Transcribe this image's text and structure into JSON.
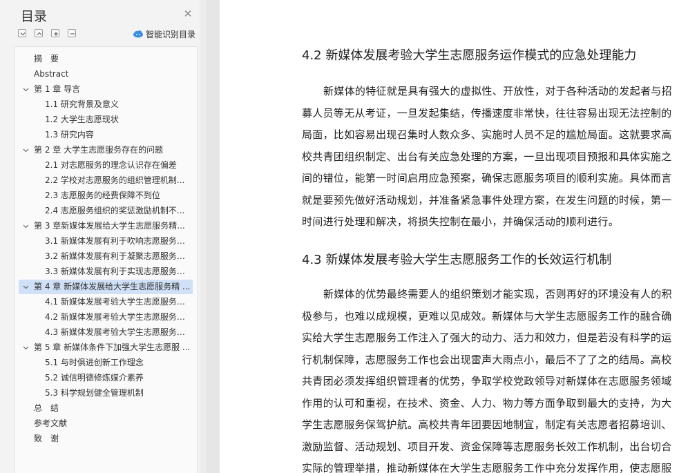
{
  "sidebar": {
    "title": "目录",
    "smart_label": "智能识别目录",
    "toc": [
      {
        "label": "摘　要",
        "level": 0,
        "chevron": false
      },
      {
        "label": "Abstract",
        "level": 0,
        "chevron": false
      },
      {
        "label": "第 1 章  导言",
        "level": 0,
        "chevron": true
      },
      {
        "label": "1.1 研究背景及意义",
        "level": 1,
        "chevron": false
      },
      {
        "label": "1.2 大学生志愿现状",
        "level": 1,
        "chevron": false
      },
      {
        "label": "1.3 研究内容",
        "level": 1,
        "chevron": false
      },
      {
        "label": "第 2 章  大学生志愿服务存在的问题",
        "level": 0,
        "chevron": true
      },
      {
        "label": "2.1 对志愿服务的理念认识存在偏差",
        "level": 1,
        "chevron": false
      },
      {
        "label": "2.2 学校对志愿服务的组织管理机制...",
        "level": 1,
        "chevron": false
      },
      {
        "label": "2.3 志愿服务的经费保障不到位",
        "level": 1,
        "chevron": false
      },
      {
        "label": "2.4 志愿服务组织的奖惩激励机制不...",
        "level": 1,
        "chevron": false
      },
      {
        "label": "第 3 章新媒体发展给大学生志愿服务精...",
        "level": 0,
        "chevron": true
      },
      {
        "label": "3.1 新媒体发展有利于吹响志愿服务 ...",
        "level": 1,
        "chevron": false
      },
      {
        "label": "3.2 新媒体发展有利于凝聚志愿服务 ...",
        "level": 1,
        "chevron": false
      },
      {
        "label": "3.3 新媒体发展有利于实现志愿服务 ...",
        "level": 1,
        "chevron": false
      },
      {
        "label": "第 4 章  新媒体发展给大学生志愿服务精 ...",
        "level": 0,
        "chevron": true,
        "active": true
      },
      {
        "label": "4.1 新媒体发展考验大学生志愿服务 ...",
        "level": 1,
        "chevron": false
      },
      {
        "label": "4.2 新媒体发展考验大学生志愿服务 ...",
        "level": 1,
        "chevron": false
      },
      {
        "label": "4.3 新媒体发展考验大学生志愿服务 ...",
        "level": 1,
        "chevron": false
      },
      {
        "label": "第 5 章  新媒体条件下加强大学生志愿服 ...",
        "level": 0,
        "chevron": true
      },
      {
        "label": "5.1 与时俱进创新工作理念",
        "level": 1,
        "chevron": false
      },
      {
        "label": "5.2 诚信明德修炼媒介素养",
        "level": 1,
        "chevron": false
      },
      {
        "label": "5.3 科学规划健全管理机制",
        "level": 1,
        "chevron": false
      },
      {
        "label": "总　结",
        "level": 0,
        "chevron": false
      },
      {
        "label": "参考文献",
        "level": 0,
        "chevron": false
      },
      {
        "label": "致　谢",
        "level": 0,
        "chevron": false
      }
    ]
  },
  "document": {
    "heading1": "4.2 新媒体发展考验大学生志愿服务运作模式的应急处理能力",
    "para1": [
      "新媒体的特征就是具有强大的虚拟性、开放性，对于各种活动的发起者与招",
      "募人员等无从考证，一旦发起集结，传播速度非常快，往往容易出现无法控制的",
      "局面，比如容易出现召集时人数众多、实施时人员不足的尴尬局面。这就要求高",
      "校共青团组织制定、出台有关应急处理的方案，一旦出现项目预报和具体实施之",
      "间的错位，能第一时间启用应急预案，确保志愿服务项目的顺利实施。具体而言",
      "就是要预先做好活动规划，并准备紧急事件处理方案，在发生问题的时候，第一",
      "时间进行处理和解决，将损失控制在最小，并确保活动的顺利进行。"
    ],
    "heading2": "4.3 新媒体发展考验大学生志愿服务工作的长效运行机制",
    "para2": [
      "新媒体的优势最终需要人的组织策划才能实现，否则再好的环境没有人的积",
      "极参与，也难以成规模，更难以见成效。新媒体与大学生志愿服务工作的融合确",
      "实给大学生志愿服务工作注入了强大的动力、活力和效力，但是若没有科学的运",
      "行机制保障，志愿服务工作也会出现雷声大雨点小，最后不了了之的结局。高校",
      "共青团必须发挥组织管理者的优势，争取学校党政领导对新媒体在志愿服务领域",
      "作用的认可和重视，在技术、资金、人力、物力等方面争取到最大的支持，为大",
      "学生志愿服务保驾护航。高校共青年团要因地制宜，制定有关志愿者招募培训、",
      "激励监督、活动规划、项目开发、资金保障等志愿服务长效工作机制，出台切合",
      "实际的管理举措，推动新媒体在大学生志愿服务工作中充分发挥作用，使志愿服"
    ]
  }
}
